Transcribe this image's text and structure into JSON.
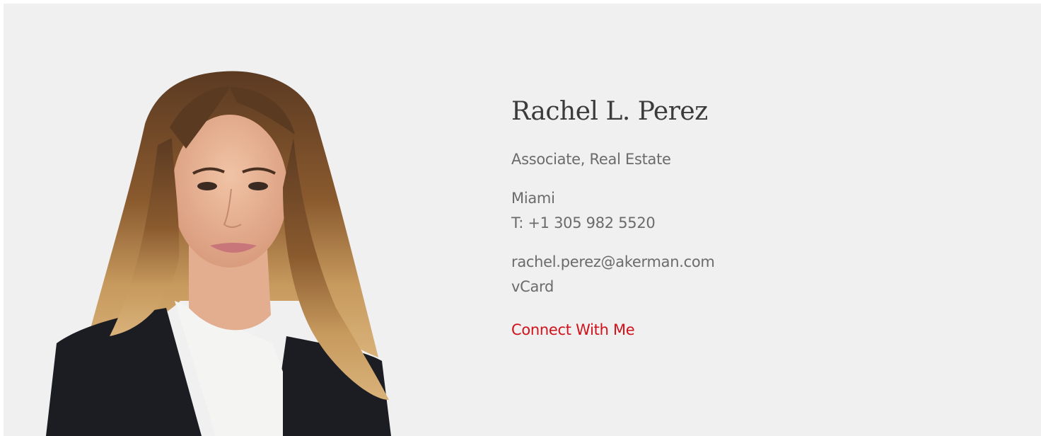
{
  "profile": {
    "name": "Rachel L. Perez",
    "title": "Associate, Real Estate",
    "office": "Miami",
    "phone": "T: +1 305 982 5520",
    "email": "rachel.perez@akerman.com",
    "vcard_label": "vCard",
    "connect_label": "Connect With Me"
  },
  "colors": {
    "background": "#f0f0f0",
    "name_text": "#3b3b3b",
    "body_text": "#6b6b6b",
    "link_accent": "#d0121b"
  }
}
